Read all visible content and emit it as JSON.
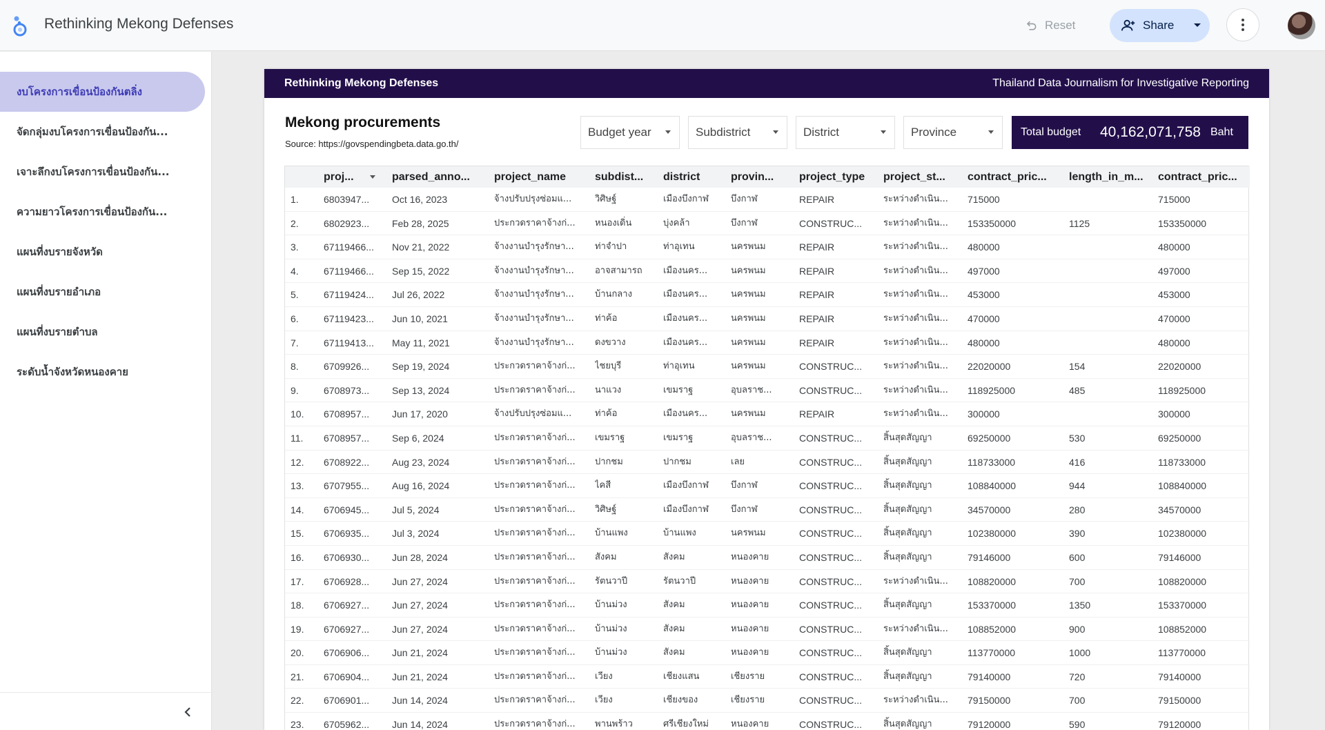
{
  "app": {
    "title": "Rethinking Mekong Defenses",
    "reset_label": "Reset",
    "share_label": "Share"
  },
  "sidebar": {
    "items": [
      {
        "label": "งบโครงการเขื่อนป้องกันตลิ่ง",
        "active": true
      },
      {
        "label": "จัดกลุ่มงบโครงการเขื่อนป้องกัน...",
        "active": false
      },
      {
        "label": "เจาะลึกงบโครงการเขื่อนป้องกัน...",
        "active": false
      },
      {
        "label": "ความยาวโครงการเขื่อนป้องกัน...",
        "active": false
      },
      {
        "label": "แผนที่งบรายจังหวัด",
        "active": false
      },
      {
        "label": "แผนที่งบรายอำเภอ",
        "active": false
      },
      {
        "label": "แผนที่งบรายตำบล",
        "active": false
      },
      {
        "label": "ระดับน้ำจังหวัดหนองคาย",
        "active": false
      }
    ]
  },
  "report": {
    "header_left": "Rethinking Mekong Defenses",
    "header_right": "Thailand Data Journalism for Investigative Reporting",
    "title": "Mekong procurements",
    "source": "Source: https://govspendingbeta.data.go.th/",
    "filters": [
      "Budget year",
      "Subdistrict",
      "District",
      "Province"
    ],
    "total_label": "Total budget",
    "total_value": "40,162,071,758",
    "total_unit": "Baht"
  },
  "table": {
    "headers": [
      "proj...",
      "parsed_anno...",
      "project_name",
      "subdist...",
      "district",
      "provin...",
      "project_type",
      "project_st...",
      "contract_pric...",
      "length_in_m...",
      "contract_pric..."
    ],
    "rows": [
      [
        "1.",
        "6803947...",
        "Oct 16, 2023",
        "จ้างปรับปรุงซ่อมแ...",
        "วิศิษฐ์",
        "เมืองบึงกาฬ",
        "บึงกาฬ",
        "REPAIR",
        "ระหว่างดำเนิน...",
        "715000",
        "",
        "715000"
      ],
      [
        "2.",
        "6802923...",
        "Feb 28, 2025",
        "ประกวดราคาจ้างก่...",
        "หนองเดิ่น",
        "บุ่งคล้า",
        "บึงกาฬ",
        "CONSTRUC...",
        "ระหว่างดำเนิน...",
        "153350000",
        "1125",
        "153350000"
      ],
      [
        "3.",
        "67119466...",
        "Nov 21, 2022",
        "จ้างงานบำรุงรักษา...",
        "ท่าจำปา",
        "ท่าอุเทน",
        "นครพนม",
        "REPAIR",
        "ระหว่างดำเนิน...",
        "480000",
        "",
        "480000"
      ],
      [
        "4.",
        "67119466...",
        "Sep 15, 2022",
        "จ้างงานบำรุงรักษา...",
        "อาจสามารถ",
        "เมืองนคร...",
        "นครพนม",
        "REPAIR",
        "ระหว่างดำเนิน...",
        "497000",
        "",
        "497000"
      ],
      [
        "5.",
        "67119424...",
        "Jul 26, 2022",
        "จ้างงานบำรุงรักษา...",
        "บ้านกลาง",
        "เมืองนคร...",
        "นครพนม",
        "REPAIR",
        "ระหว่างดำเนิน...",
        "453000",
        "",
        "453000"
      ],
      [
        "6.",
        "67119423...",
        "Jun 10, 2021",
        "จ้างงานบำรุงรักษา...",
        "ท่าค้อ",
        "เมืองนคร...",
        "นครพนม",
        "REPAIR",
        "ระหว่างดำเนิน...",
        "470000",
        "",
        "470000"
      ],
      [
        "7.",
        "67119413...",
        "May 11, 2021",
        "จ้างงานบำรุงรักษา...",
        "ดงขวาง",
        "เมืองนคร...",
        "นครพนม",
        "REPAIR",
        "ระหว่างดำเนิน...",
        "480000",
        "",
        "480000"
      ],
      [
        "8.",
        "6709926...",
        "Sep 19, 2024",
        "ประกวดราคาจ้างก่...",
        "ไชยบุรี",
        "ท่าอุเทน",
        "นครพนม",
        "CONSTRUC...",
        "ระหว่างดำเนิน...",
        "22020000",
        "154",
        "22020000"
      ],
      [
        "9.",
        "6708973...",
        "Sep 13, 2024",
        "ประกวดราคาจ้างก่...",
        "นาแวง",
        "เขมราฐ",
        "อุบลราช...",
        "CONSTRUC...",
        "ระหว่างดำเนิน...",
        "118925000",
        "485",
        "118925000"
      ],
      [
        "10.",
        "6708957...",
        "Jun 17, 2020",
        "จ้างปรับปรุงซ่อมแ...",
        "ท่าค้อ",
        "เมืองนคร...",
        "นครพนม",
        "REPAIR",
        "ระหว่างดำเนิน...",
        "300000",
        "",
        "300000"
      ],
      [
        "11.",
        "6708957...",
        "Sep 6, 2024",
        "ประกวดราคาจ้างก่...",
        "เขมราฐ",
        "เขมราฐ",
        "อุบลราช...",
        "CONSTRUC...",
        "สิ้นสุดสัญญา",
        "69250000",
        "530",
        "69250000"
      ],
      [
        "12.",
        "6708922...",
        "Aug 23, 2024",
        "ประกวดราคาจ้างก่...",
        "ปากชม",
        "ปากชม",
        "เลย",
        "CONSTRUC...",
        "สิ้นสุดสัญญา",
        "118733000",
        "416",
        "118733000"
      ],
      [
        "13.",
        "6707955...",
        "Aug 16, 2024",
        "ประกวดราคาจ้างก่...",
        "ไคสี",
        "เมืองบึงกาฬ",
        "บึงกาฬ",
        "CONSTRUC...",
        "สิ้นสุดสัญญา",
        "108840000",
        "944",
        "108840000"
      ],
      [
        "14.",
        "6706945...",
        "Jul 5, 2024",
        "ประกวดราคาจ้างก่...",
        "วิศิษฐ์",
        "เมืองบึงกาฬ",
        "บึงกาฬ",
        "CONSTRUC...",
        "สิ้นสุดสัญญา",
        "34570000",
        "280",
        "34570000"
      ],
      [
        "15.",
        "6706935...",
        "Jul 3, 2024",
        "ประกวดราคาจ้างก่...",
        "บ้านแพง",
        "บ้านแพง",
        "นครพนม",
        "CONSTRUC...",
        "สิ้นสุดสัญญา",
        "102380000",
        "390",
        "102380000"
      ],
      [
        "16.",
        "6706930...",
        "Jun 28, 2024",
        "ประกวดราคาจ้างก่...",
        "สังคม",
        "สังคม",
        "หนองคาย",
        "CONSTRUC...",
        "สิ้นสุดสัญญา",
        "79146000",
        "600",
        "79146000"
      ],
      [
        "17.",
        "6706928...",
        "Jun 27, 2024",
        "ประกวดราคาจ้างก่...",
        "รัตนวาปี",
        "รัตนวาปี",
        "หนองคาย",
        "CONSTRUC...",
        "ระหว่างดำเนิน...",
        "108820000",
        "700",
        "108820000"
      ],
      [
        "18.",
        "6706927...",
        "Jun 27, 2024",
        "ประกวดราคาจ้างก่...",
        "บ้านม่วง",
        "สังคม",
        "หนองคาย",
        "CONSTRUC...",
        "สิ้นสุดสัญญา",
        "153370000",
        "1350",
        "153370000"
      ],
      [
        "19.",
        "6706927...",
        "Jun 27, 2024",
        "ประกวดราคาจ้างก่...",
        "บ้านม่วง",
        "สังคม",
        "หนองคาย",
        "CONSTRUC...",
        "ระหว่างดำเนิน...",
        "108852000",
        "900",
        "108852000"
      ],
      [
        "20.",
        "6706906...",
        "Jun 21, 2024",
        "ประกวดราคาจ้างก่...",
        "บ้านม่วง",
        "สังคม",
        "หนองคาย",
        "CONSTRUC...",
        "สิ้นสุดสัญญา",
        "113770000",
        "1000",
        "113770000"
      ],
      [
        "21.",
        "6706904...",
        "Jun 21, 2024",
        "ประกวดราคาจ้างก่...",
        "เวียง",
        "เชียงแสน",
        "เชียงราย",
        "CONSTRUC...",
        "สิ้นสุดสัญญา",
        "79140000",
        "720",
        "79140000"
      ],
      [
        "22.",
        "6706901...",
        "Jun 14, 2024",
        "ประกวดราคาจ้างก่...",
        "เวียง",
        "เชียงของ",
        "เชียงราย",
        "CONSTRUC...",
        "ระหว่างดำเนิน...",
        "79150000",
        "700",
        "79150000"
      ],
      [
        "23.",
        "6705962...",
        "Jun 14, 2024",
        "ประกวดราคาจ้างก่...",
        "พานพร้าว",
        "ศรีเชียงใหม่",
        "หนองคาย",
        "CONSTRUC...",
        "สิ้นสุดสัญญา",
        "79120000",
        "590",
        "79120000"
      ]
    ]
  },
  "colors": {
    "header_bg": "#220f4a",
    "active_nav_bg": "#c9c9ee",
    "active_nav_text": "#3d3bb5",
    "share_bg": "#d3e3fd"
  },
  "icons": {
    "logo": "looker-studio-logo-icon",
    "reset": "undo-icon",
    "share": "person-add-icon",
    "more": "more-vert-icon",
    "collapse": "chevron-left-icon"
  }
}
